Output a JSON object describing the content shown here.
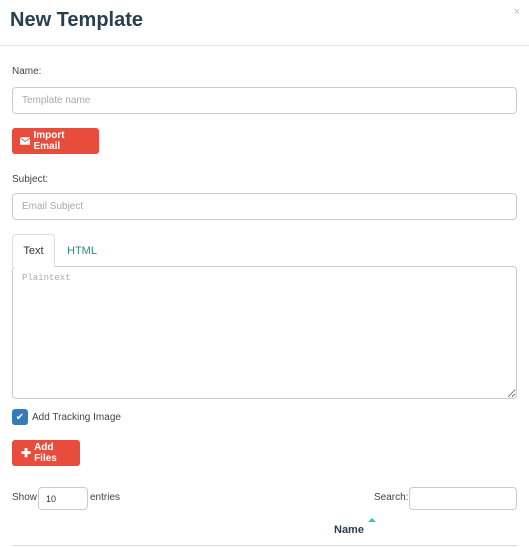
{
  "modal": {
    "title": "New Template",
    "close": "×"
  },
  "form": {
    "name_label": "Name:",
    "name_placeholder": "Template name",
    "import_label": "Import Email",
    "subject_label": "Subject:",
    "subject_placeholder": "Email Subject",
    "tabs": [
      {
        "label": "Text",
        "active": true
      },
      {
        "label": "HTML",
        "active": false
      }
    ],
    "text_placeholder": "Plaintext",
    "tracking_label": "Add Tracking Image",
    "tracking_checked": true,
    "add_files_label": "Add Files"
  },
  "table": {
    "show_label": "Show",
    "entries_value": "10",
    "entries_label": "entries",
    "search_label": "Search:",
    "search_value": "",
    "columns": [
      {
        "label": "Name",
        "sort": "ascending"
      }
    ]
  },
  "colors": {
    "accent": "#e74c3c",
    "checkbox": "#337ab7",
    "sort": "#3ec6a0"
  }
}
